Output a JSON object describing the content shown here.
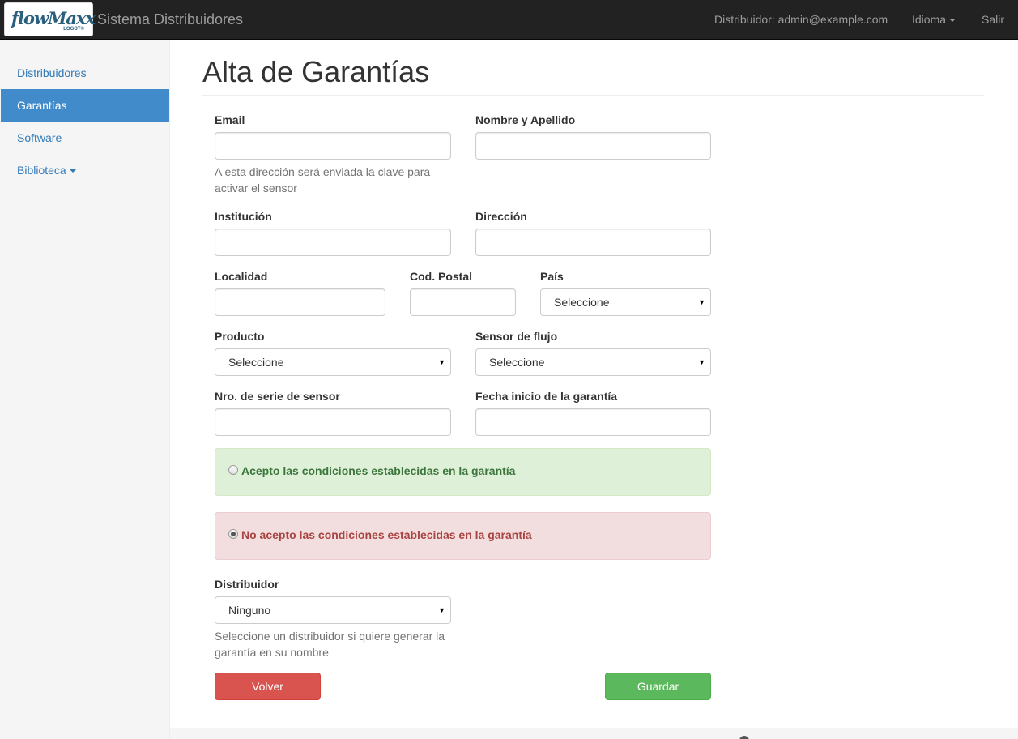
{
  "navbar": {
    "logo_text": "flowMaxx",
    "logo_sub": "LOGOT®",
    "brand": "Sistema Distribuidores",
    "user": "Distribuidor: admin@example.com",
    "idioma": "Idioma",
    "salir": "Salir"
  },
  "sidebar": {
    "items": [
      {
        "label": "Distribuidores"
      },
      {
        "label": "Garantías"
      },
      {
        "label": "Software"
      },
      {
        "label": "Biblioteca"
      }
    ]
  },
  "page": {
    "title": "Alta de Garantías"
  },
  "form": {
    "email_label": "Email",
    "email_help": "A esta dirección será enviada la clave para activar el sensor",
    "nombre_label": "Nombre y Apellido",
    "institucion_label": "Institución",
    "direccion_label": "Dirección",
    "localidad_label": "Localidad",
    "postal_label": "Cod. Postal",
    "pais_label": "País",
    "pais_value": "Seleccione",
    "producto_label": "Producto",
    "producto_value": "Seleccione",
    "sensor_label": "Sensor de flujo",
    "sensor_value": "Seleccione",
    "serie_label": "Nro. de serie de sensor",
    "fecha_label": "Fecha inicio de la garantía",
    "acepto_label": "Acepto las condiciones establecidas en la garantía",
    "no_acepto_label": "No acepto las condiciones establecidas en la garantía",
    "distribuidor_label": "Distribuidor",
    "distribuidor_value": "Ninguno",
    "distribuidor_help": "Seleccione un distribuidor si quiere generar la garantía en su nombre",
    "volver": "Volver",
    "guardar": "Guardar"
  },
  "colors": {
    "navbar": "#222222",
    "sidebar_active": "#428bca",
    "success": "#5cb85c",
    "danger": "#d9534f"
  }
}
